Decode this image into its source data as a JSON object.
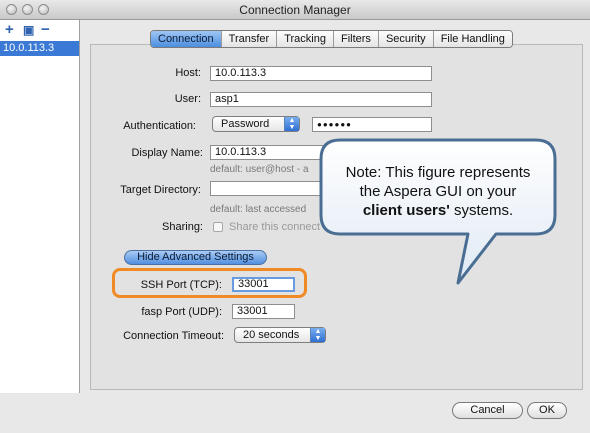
{
  "window": {
    "title": "Connection Manager"
  },
  "sidebar": {
    "tools": {
      "add": "+",
      "copy": "▣",
      "remove": "−"
    },
    "hosts": [
      "10.0.113.3"
    ]
  },
  "tabs": [
    {
      "label": "Connection",
      "active": true
    },
    {
      "label": "Transfer",
      "active": false
    },
    {
      "label": "Tracking",
      "active": false
    },
    {
      "label": "Filters",
      "active": false
    },
    {
      "label": "Security",
      "active": false
    },
    {
      "label": "File Handling",
      "active": false
    }
  ],
  "form": {
    "host_label": "Host:",
    "host_value": "10.0.113.3",
    "user_label": "User:",
    "user_value": "asp1",
    "auth_label": "Authentication:",
    "auth_value": "Password",
    "password_mask": "●●●●●●",
    "display_name_label": "Display Name:",
    "display_name_value": "10.0.113.3",
    "display_name_hint": "default: user@host - a",
    "target_dir_label": "Target Directory:",
    "target_dir_value": "",
    "target_dir_hint": "default: last accessed",
    "sharing_label": "Sharing:",
    "sharing_text": "Share this connect",
    "advanced_button": "Hide Advanced Settings",
    "ssh_port_label": "SSH Port (TCP):",
    "ssh_port_value": "33001",
    "fasp_port_label": "fasp Port (UDP):",
    "fasp_port_value": "33001",
    "timeout_label": "Connection Timeout:",
    "timeout_value": "20 seconds"
  },
  "buttons": {
    "cancel": "Cancel",
    "ok": "OK"
  },
  "callout": {
    "line1": "Note: This figure represents",
    "line2": "the Aspera GUI on your",
    "line3_bold": "client users'",
    "line3_rest": " systems."
  },
  "colors": {
    "selection": "#3a79d6",
    "accent_blue": "#4c8ee0",
    "highlight_orange": "#f08a24",
    "callout_border": "#4a6d93"
  },
  "icons": {
    "traffic_lights": "window-control-icons",
    "popup_arrows": "updown-arrow-icon"
  }
}
